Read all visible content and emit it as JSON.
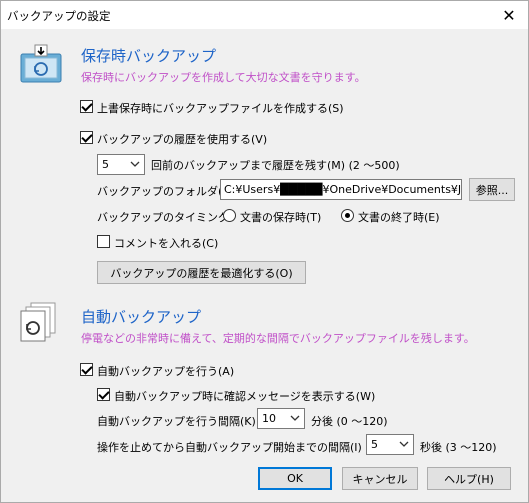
{
  "window": {
    "title": "バックアップの設定",
    "close_glyph": "✕"
  },
  "save_backup": {
    "title": "保存時バックアップ",
    "description": "保存時にバックアップを作成して大切な文書を守ります。",
    "overwrite_checkbox": {
      "label": "上書保存時にバックアップファイルを作成する(S)",
      "checked": true
    },
    "history_checkbox": {
      "label": "バックアップの履歴を使用する(V)",
      "checked": true
    },
    "history_count": {
      "value": "5",
      "suffix": "回前のバックアップまで履歴を残す(M) (2 ～500)"
    },
    "folder": {
      "label": "バックアップのフォルダ(F)",
      "path": "C:¥Users¥█████¥OneDrive¥Documents¥Justsy",
      "browse_label": "参照..."
    },
    "timing": {
      "label": "バックアップのタイミング",
      "options": [
        {
          "label": "文書の保存時(T)",
          "selected": false
        },
        {
          "label": "文書の終了時(E)",
          "selected": true
        }
      ]
    },
    "comment_checkbox": {
      "label": "コメントを入れる(C)",
      "checked": false
    },
    "optimize_button": "バックアップの履歴を最適化する(O)"
  },
  "auto_backup": {
    "title": "自動バックアップ",
    "description": "停電などの非常時に備えて、定期的な間隔でバックアップファイルを残します。",
    "enable_checkbox": {
      "label": "自動バックアップを行う(A)",
      "checked": true
    },
    "confirm_checkbox": {
      "label": "自動バックアップ時に確認メッセージを表示する(W)",
      "checked": true
    },
    "interval": {
      "label": "自動バックアップを行う間隔(K)",
      "value": "10",
      "suffix": "分後 (0 ～120)"
    },
    "idle_interval": {
      "label": "操作を止めてから自動バックアップ開始までの間隔(I)",
      "value": "5",
      "suffix": "秒後 (3 ～120)"
    }
  },
  "buttons": {
    "ok": "OK",
    "cancel": "キャンセル",
    "help": "ヘルプ(H)"
  },
  "colors": {
    "section_title": "#1e64c8",
    "section_desc": "#c050c8",
    "default_border": "#0078d7"
  }
}
